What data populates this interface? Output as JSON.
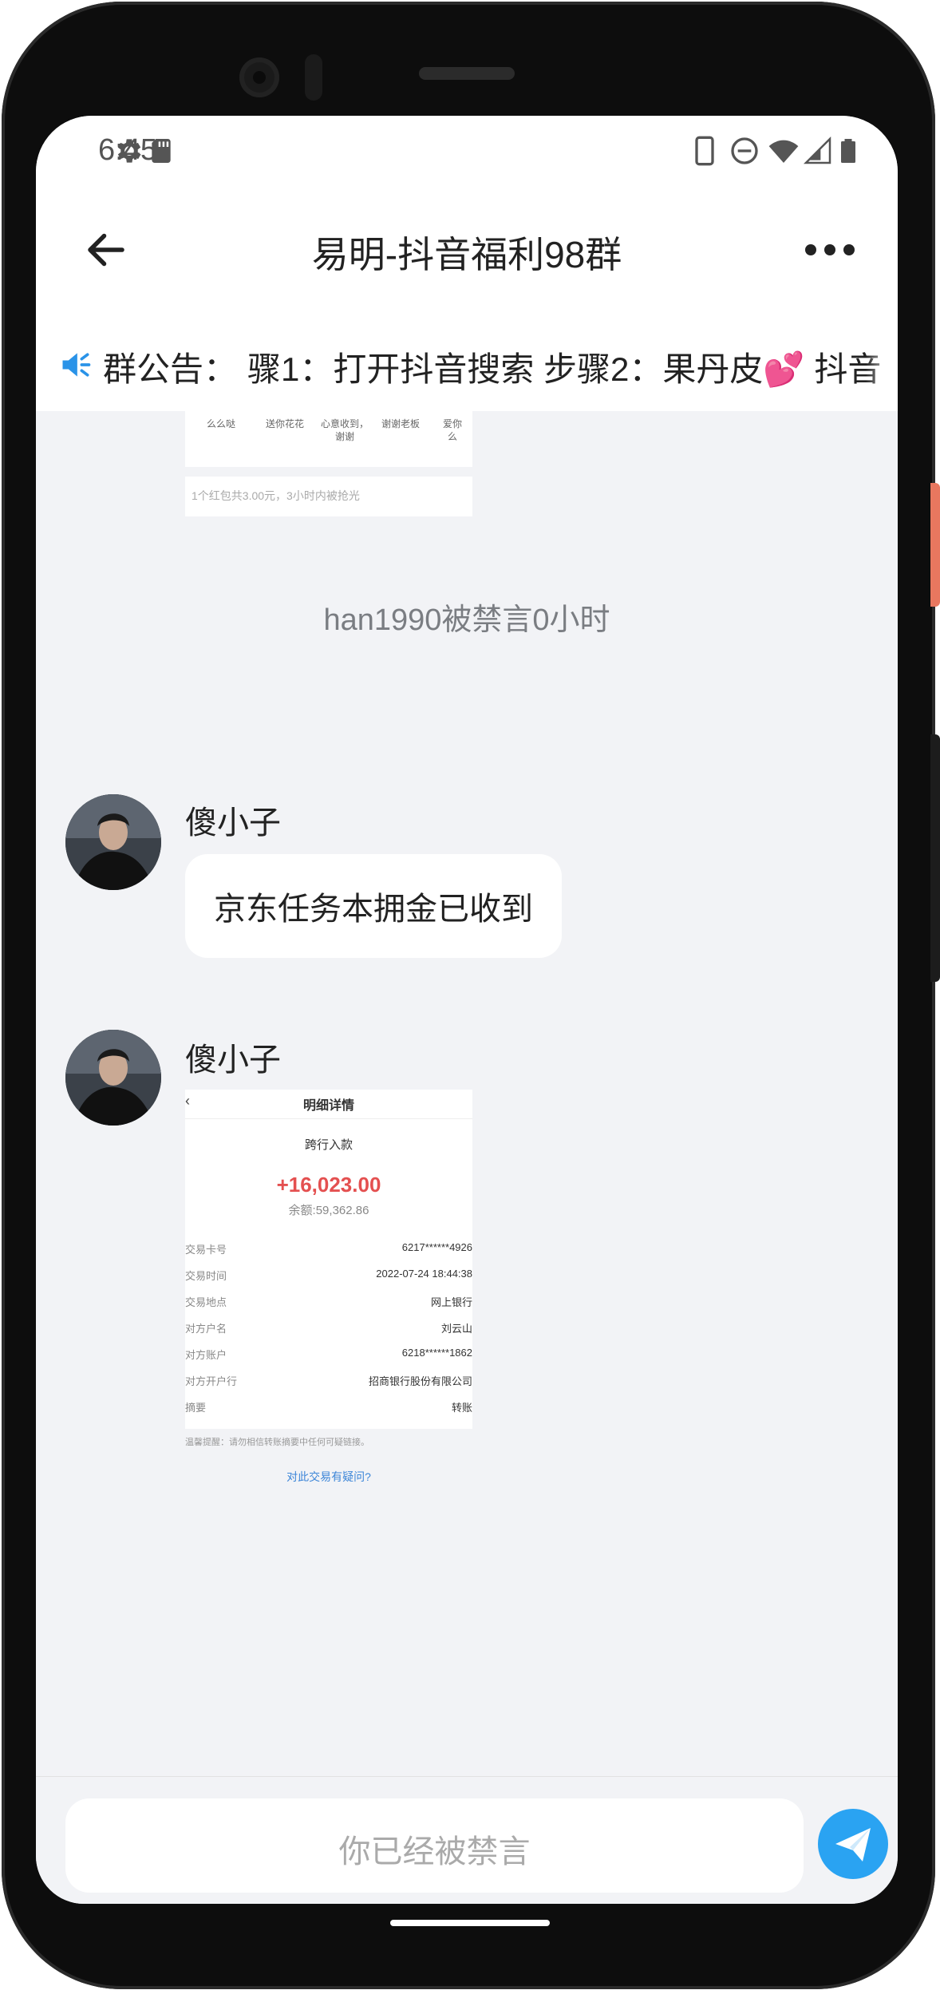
{
  "status_bar": {
    "time": "6:45",
    "icons_left": [
      "gear-icon",
      "sd-card-icon"
    ],
    "icons_right": [
      "phone-icon",
      "do-not-disturb-icon",
      "wifi-icon",
      "signal-icon",
      "battery-icon"
    ]
  },
  "nav": {
    "title": "易明-抖音福利98群"
  },
  "notice": {
    "label": "群公告：",
    "text": "骤1：打开抖音搜索 步骤2：果丹皮💕 抖音"
  },
  "chat": {
    "gift_card": {
      "items": [
        "么么哒",
        "送你花花",
        "心意收到，\n谢谢",
        "谢谢老板",
        "爱你\n么"
      ],
      "footer": "1个红包共3.00元，3小时内被抢光"
    },
    "system_message": "han1990被禁言0小时",
    "messages": [
      {
        "sender": "傻小子",
        "text": "京东任务本拥金已收到"
      },
      {
        "sender": "傻小子",
        "text": ""
      }
    ],
    "receipt": {
      "title": "明细详情",
      "type": "跨行入款",
      "amount": "+16,023.00",
      "balance": "余额:59,362.86",
      "rows": [
        {
          "k": "交易卡号",
          "v": "6217******4926"
        },
        {
          "k": "交易时间",
          "v": "2022-07-24 18:44:38"
        },
        {
          "k": "交易地点",
          "v": "网上银行"
        },
        {
          "k": "对方户名",
          "v": "刘云山"
        },
        {
          "k": "对方账户",
          "v": "6218******1862"
        },
        {
          "k": "对方开户行",
          "v": "招商银行股份有限公司"
        },
        {
          "k": "摘要",
          "v": "转账"
        }
      ],
      "tip": "温馨提醒：请勿相信转账摘要中任何可疑链接。",
      "link": "对此交易有疑问?"
    }
  },
  "input": {
    "placeholder": "你已经被禁言"
  },
  "toolbar": {
    "items": [
      "microphone-icon",
      "image-icon",
      "camera-icon",
      "emoji-icon",
      "plus-icon"
    ]
  },
  "colors": {
    "accent": "#2aa3f2",
    "amount_red": "#e45050",
    "chat_bg": "#f2f3f6"
  }
}
